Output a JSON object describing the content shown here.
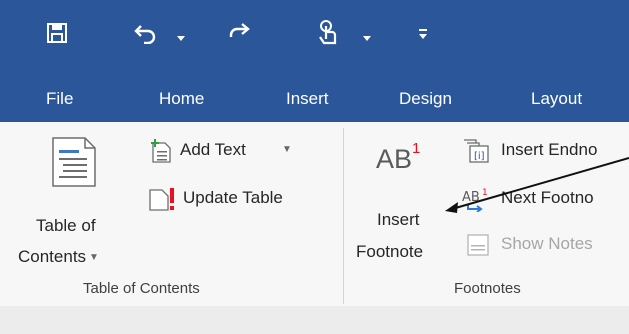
{
  "quick_access": {
    "icons": [
      "save-icon",
      "undo-icon",
      "redo-icon",
      "touch-mode-icon",
      "customize-qat-icon"
    ]
  },
  "tabs": [
    "File",
    "Home",
    "Insert",
    "Design",
    "Layout"
  ],
  "toc_group": {
    "button_line1": "Table of",
    "button_line2": "Contents",
    "add_text": "Add Text",
    "update_table": "Update Table",
    "label": "Table of Contents"
  },
  "footnotes_group": {
    "ab_text": "AB",
    "sup_text": "1",
    "insert_line1": "Insert",
    "insert_line2": "Footnote",
    "insert_endnote": "Insert Endno",
    "next_footnote": "Next Footno",
    "show_notes": "Show Notes",
    "label": "Footnotes"
  },
  "colors": {
    "title_bar": "#2b579a",
    "accent_red": "#e81123"
  }
}
